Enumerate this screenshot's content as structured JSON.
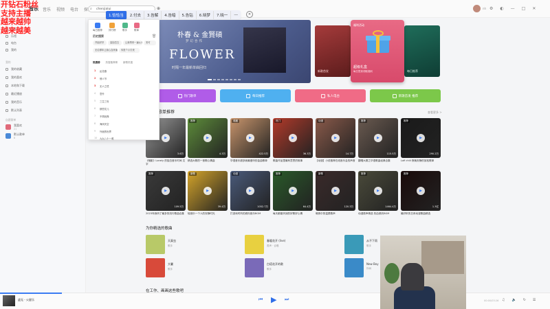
{
  "overlay": [
    "开钻石粉丝",
    "支持主播",
    "越来越帅",
    "越来越美"
  ],
  "app": {
    "logo": "音乐",
    "nav": [
      "音乐",
      "视频",
      "电台",
      "探索"
    ],
    "search_value": "chenjialui",
    "user_name": "nh"
  },
  "song_tabs": [
    "1.恰恰当",
    "2.付去",
    "3.告解",
    "4.告暗",
    "5.告钻",
    "6.晓梦",
    "7.晓一"
  ],
  "sidebar": {
    "items": [
      "推荐",
      "乐馆",
      "电台",
      "我的"
    ],
    "section_mine": "我的",
    "mine": [
      "我的收藏",
      "我的喜欢",
      "本地和下载",
      "最近播放",
      "我的音乐",
      "默认列表"
    ],
    "section_playlists": "自建歌单",
    "playlists": [
      {
        "name": "我喜欢",
        "sub": "21"
      },
      {
        "name": "默认歌单",
        "sub": "6"
      }
    ]
  },
  "dropdown": {
    "quick": [
      "每日推荐",
      "排行榜",
      "歌手",
      "歌单"
    ],
    "history_title": "历史搜索",
    "history": [
      "开始好好",
      "高抬四五",
      "让我再来一遍从头",
      "安可",
      "无论哪年让我心血来潮",
      "你是个小贝壳"
    ],
    "tabs": [
      "热搜榜",
      "热搜推荐榜",
      "新歌热搜"
    ],
    "hot": [
      "乱花春",
      "情人节",
      "无人之境",
      "意外",
      "三生三世",
      "那些花儿",
      "不再犹豫",
      "海阔天空",
      "外面的世界",
      "九九八十一难"
    ]
  },
  "banner": {
    "title_line": "朴春 & 金賢碩",
    "sub_line": "梦幻合作",
    "main": "FLOWER",
    "caption": "时隔一年最新单曲回归",
    "front_tag": "福利活动",
    "front_name": "超级礼盒",
    "front_sub": "每日签到领取福利",
    "side1_text": "新歌首发",
    "side2_text": "每日推荐"
  },
  "buttons": [
    {
      "label": "热门歌单",
      "color": "#b05ce8"
    },
    {
      "label": "每日推荐",
      "color": "#4fb0f0"
    },
    {
      "label": "私人电台",
      "color": "#f06b86"
    },
    {
      "label": "新歌首发 推荐",
      "color": "#7cc84a"
    }
  ],
  "section": {
    "title": "歌单推荐",
    "more": "查看更多 >"
  },
  "cards": [
    {
      "badge": "热门",
      "plays": "3.6万",
      "caption": "《暗影》Lonely 的独白音乐时间 文字",
      "color": "#9a9a9a"
    },
    {
      "badge": "推荐",
      "plays": "4.3万",
      "caption": "精选大歌的一首歌心情曲",
      "color": "#5d8c3a"
    },
    {
      "badge": "收藏",
      "plays": "422.5万",
      "caption": "华语音乐超多我最爱听的金曲歌单",
      "color": "#c8956c"
    },
    {
      "badge": "热门",
      "plays": "36.3万",
      "caption": "歌曲作品里最有意思的故事",
      "color": "#b23a2a"
    },
    {
      "badge": "动漫",
      "plays": "14.7万",
      "caption": "【动漫】小说推荐在线音乐会的声音",
      "color": "#8a5a4a"
    },
    {
      "badge": "推荐",
      "plays": "115.5万",
      "caption": "翻唱大赛之华语歌曲经典合集",
      "color": "#6a5a50"
    },
    {
      "badge": "推荐",
      "plays": "290.2万",
      "caption": "Lofi chill 夜晚安静的放松歌单",
      "color": "#1a1a1a"
    },
    {
      "badge": "推荐",
      "plays": "109.5万",
      "caption": "2023年我听了最多的流行歌曲合集",
      "color": "#3a3a3a"
    },
    {
      "badge": "新歌",
      "plays": "39.4万",
      "caption": "轻音乐一个人的安静时光",
      "color": "#d4a42a"
    },
    {
      "badge": "动漫",
      "plays": "1052.7万",
      "caption": "打游戏时听的燃向音乐BGM",
      "color": "#4a5a7a"
    },
    {
      "badge": "推荐",
      "plays": "64.4万",
      "caption": "每天都能听到的好歌好心情",
      "color": "#2a5a2a"
    },
    {
      "badge": "新歌",
      "plays": "120.3万",
      "caption": "暗夜中的温柔歌声",
      "color": "#3a2a2a"
    },
    {
      "badge": "推荐",
      "plays": "1464.4万",
      "caption": "动漫原声精选 热血燃向BGM",
      "color": "#4a4a3a"
    },
    {
      "badge": "推荐",
      "plays": "1.3亿",
      "caption": "最好听的日系动漫歌曲精选",
      "color": "#1a0a0a"
    }
  ],
  "recommend": {
    "title": "为你精选的歌曲",
    "songs": [
      {
        "name": "天真虫",
        "artist": "歌手",
        "color": "#b8c968"
      },
      {
        "name": "春暖花开 (live)",
        "artist": "男声 · 合唱",
        "color": "#e8d040"
      },
      {
        "name": "从不下雨",
        "artist": "歌手",
        "color": "#3a9ab8"
      },
      {
        "name": "大暑",
        "artist": "歌手",
        "color": "#d84a3a"
      },
      {
        "name": "白塔花开的歌",
        "artist": "歌手",
        "color": "#7a6ab8"
      },
      {
        "name": "New Boy",
        "artist": "朴树",
        "color": "#3a8ac8"
      }
    ]
  },
  "working": "在工作、画画这些歌吧",
  "player": {
    "now_playing": "虚无 - 火星乐",
    "time": "00:00/03:26"
  }
}
